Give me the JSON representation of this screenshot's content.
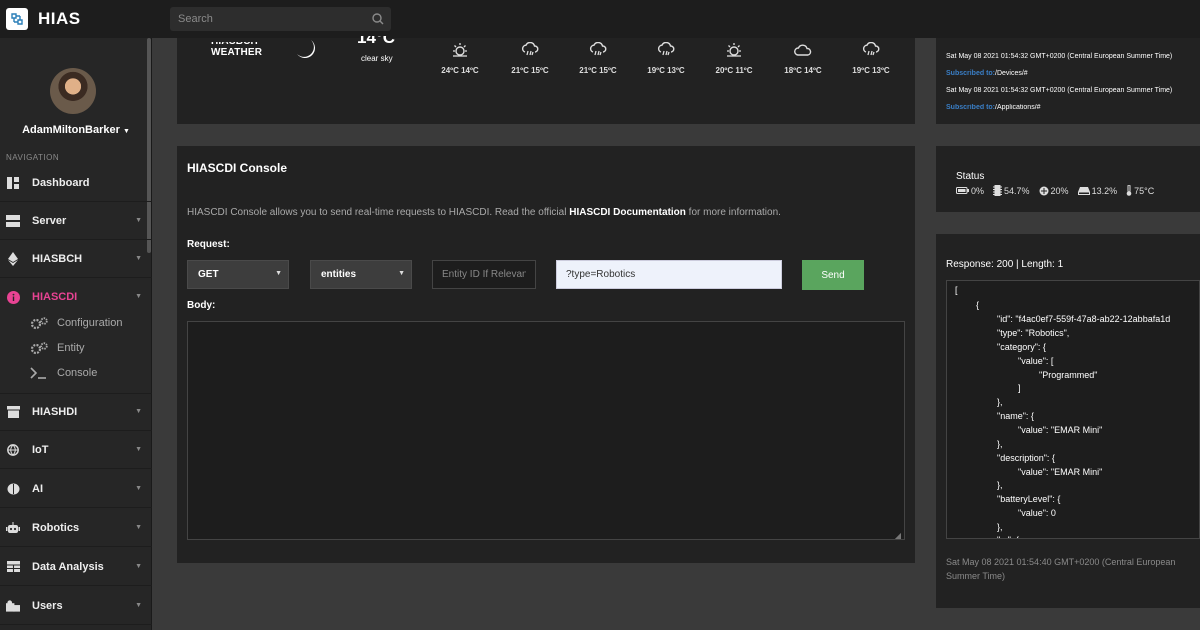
{
  "app": {
    "brand": "HIAS"
  },
  "search": {
    "placeholder": "Search"
  },
  "user": {
    "name": "AdamMiltonBarker"
  },
  "nav": {
    "label": "NAVIGATION",
    "items": [
      {
        "label": "Dashboard",
        "icon": "dashboard-icon"
      },
      {
        "label": "Server",
        "icon": "server-icon"
      },
      {
        "label": "HIASBCH",
        "icon": "ethereum-icon"
      },
      {
        "label": "HIASCDI",
        "icon": "info-circle-icon"
      },
      {
        "label": "HIASHDI",
        "icon": "archive-icon"
      },
      {
        "label": "IoT",
        "icon": "globe-icon"
      },
      {
        "label": "AI",
        "icon": "brain-icon"
      },
      {
        "label": "Robotics",
        "icon": "robot-icon"
      },
      {
        "label": "Data Analysis",
        "icon": "table-icon"
      },
      {
        "label": "Users",
        "icon": "users-icon"
      }
    ],
    "sub_items": [
      {
        "label": "Configuration",
        "icon": "cogs-icon"
      },
      {
        "label": "Entity",
        "icon": "cogs-icon"
      },
      {
        "label": "Console",
        "icon": "terminal-icon"
      }
    ],
    "active": "HIASCDI"
  },
  "weather": {
    "brand_top": "HIASBCH",
    "brand_bottom": "WEATHER",
    "current_temp": "14°C",
    "current_desc": "clear sky",
    "forecast": [
      {
        "temps": "24ºC  14ºC",
        "icon": "sun-icon"
      },
      {
        "temps": "21ºC  15ºC",
        "icon": "rain-icon"
      },
      {
        "temps": "21ºC  15ºC",
        "icon": "rain-icon"
      },
      {
        "temps": "19ºC  13ºC",
        "icon": "rain-icon"
      },
      {
        "temps": "20ºC  11ºC",
        "icon": "sun-icon"
      },
      {
        "temps": "18ºC  14ºC",
        "icon": "cloud-icon"
      },
      {
        "temps": "19ºC  13ºC",
        "icon": "rain-icon"
      }
    ]
  },
  "console": {
    "title": "HIASCDI Console",
    "desc_pre": "HIASCDI Console allows you to send real-time requests to HIASCDI. Read the official ",
    "desc_link": "HIASCDI Documentation",
    "desc_post": " for more information.",
    "request_label": "Request:",
    "method": "GET",
    "endpoint": "entities",
    "entity_placeholder": "Entity ID If Relevant",
    "query_value": "?type=Robotics",
    "send_label": "Send",
    "body_label": "Body:"
  },
  "log": {
    "lines": [
      "Sat May 08 2021 01:54:32 GMT+0200 (Central European Summer Time)",
      "Sat May 08 2021 01:54:32 GMT+0200 (Central European Summer Time)"
    ],
    "subscriptions": [
      {
        "prefix": "Subscribed to:",
        "topic": "/Devices/#"
      },
      {
        "prefix": "Subscribed to:",
        "topic": "/Applications/#"
      }
    ]
  },
  "status": {
    "title": "Status",
    "battery": "0%",
    "cpu": "54.7%",
    "memory": "20%",
    "disk": "13.2%",
    "temperature": "75°C"
  },
  "response": {
    "title": "Response: 200 | Length: 1",
    "json_lines": [
      "[",
      "{",
      "\"id\": \"f4ac0ef7-559f-47a8-ab22-12abbafa1d",
      "\"type\": \"Robotics\",",
      "\"category\": {",
      "\"value\": [",
      "\"Programmed\"",
      "]",
      "},",
      "\"name\": {",
      "\"value\": \"EMAR Mini\"",
      "},",
      "\"description\": {",
      "\"value\": \"EMAR Mini\"",
      "},",
      "\"batteryLevel\": {",
      "\"value\": 0",
      "},",
      "\"...\": {"
    ],
    "timestamp": "Sat May 08 2021 01:54:40 GMT+0200 (Central European Summer Time)"
  },
  "colors": {
    "accent_active": "#e84393",
    "send_button": "#5aa55e",
    "link_blue": "#3a7fc7"
  }
}
